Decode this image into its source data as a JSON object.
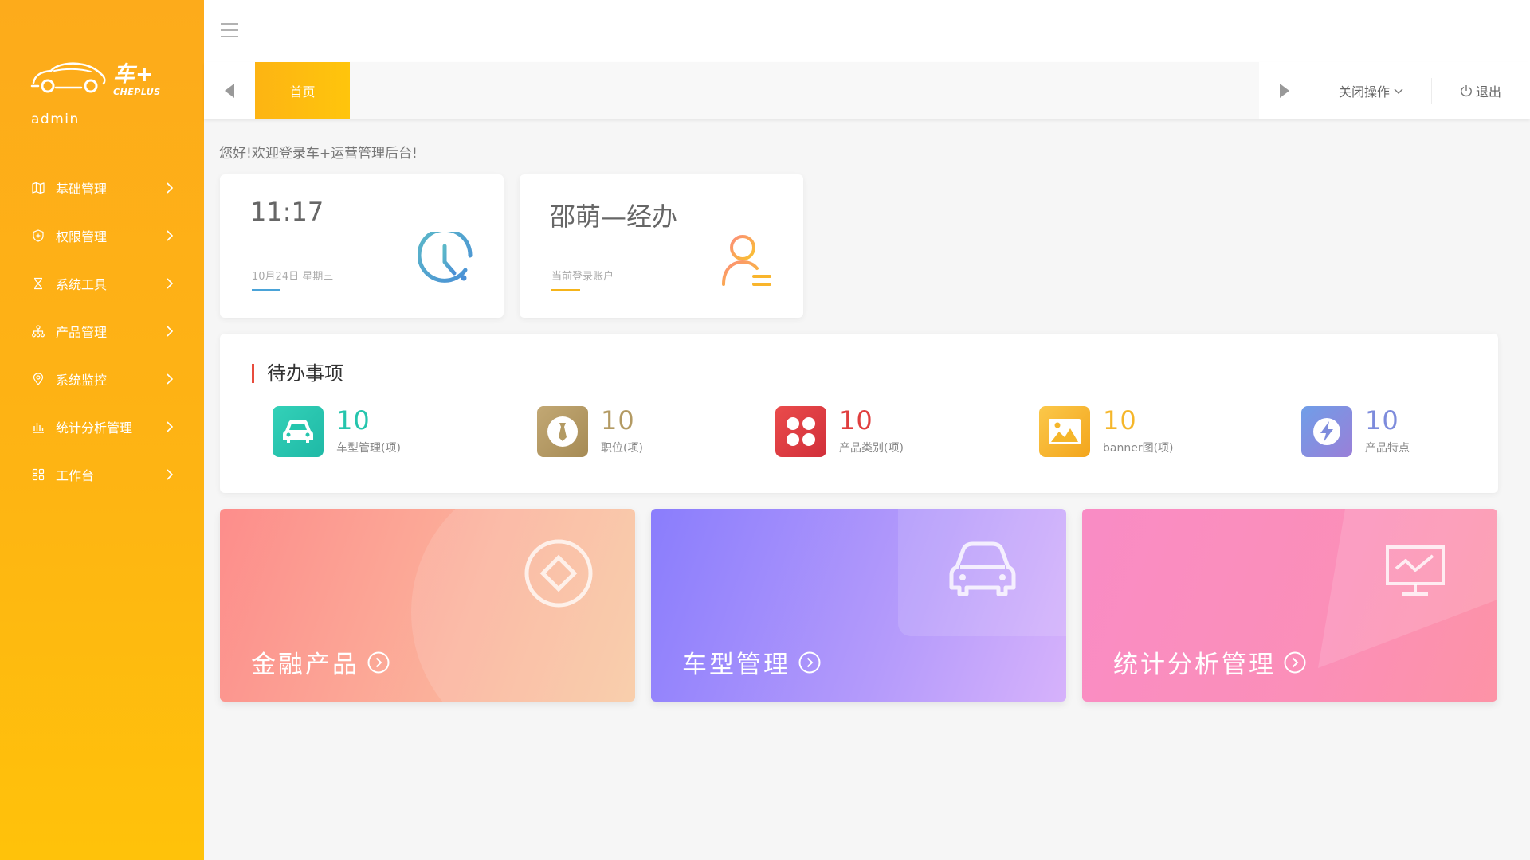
{
  "sidebar": {
    "logo": {
      "cn": "车+",
      "en": "CHEPLUS"
    },
    "user": "admin",
    "items": [
      {
        "label": "基础管理",
        "icon": "map-icon"
      },
      {
        "label": "权限管理",
        "icon": "shield-plus-icon"
      },
      {
        "label": "系统工具",
        "icon": "hourglass-icon"
      },
      {
        "label": "产品管理",
        "icon": "sitemap-icon"
      },
      {
        "label": "系统监控",
        "icon": "location-icon"
      },
      {
        "label": "统计分析管理",
        "icon": "bar-chart-icon"
      },
      {
        "label": "工作台",
        "icon": "grid-icon"
      }
    ]
  },
  "tabs": {
    "home": "首页",
    "close_ops": "关闭操作",
    "logout": "退出"
  },
  "welcome": "您好!欢迎登录车+运营管理后台!",
  "time_card": {
    "time": "11:17",
    "date": "10月24日 星期三",
    "accent": "#4aa3d8"
  },
  "user_card": {
    "name": "邵萌—经办",
    "caption": "当前登录账户",
    "accent": "#f5b41a"
  },
  "todo": {
    "title": "待办事项",
    "items": [
      {
        "count": "10",
        "label": "车型管理(项)",
        "color": "#25c5ad",
        "icon": "car-icon"
      },
      {
        "count": "10",
        "label": "职位(项)",
        "color": "#b39a63",
        "icon": "tie-icon"
      },
      {
        "count": "10",
        "label": "产品类别(项)",
        "color": "#e03e3e",
        "icon": "clover-icon"
      },
      {
        "count": "10",
        "label": "banner图(项)",
        "color": "#f5b62a",
        "icon": "image-icon"
      },
      {
        "count": "10",
        "label": "产品特点",
        "color": "#7d8bdc",
        "icon": "lightning-icon"
      }
    ]
  },
  "big_cards": [
    {
      "label": "金融产品",
      "icon": "diamond-icon"
    },
    {
      "label": "车型管理",
      "icon": "car-icon"
    },
    {
      "label": "统计分析管理",
      "icon": "monitor-chart-icon"
    }
  ]
}
